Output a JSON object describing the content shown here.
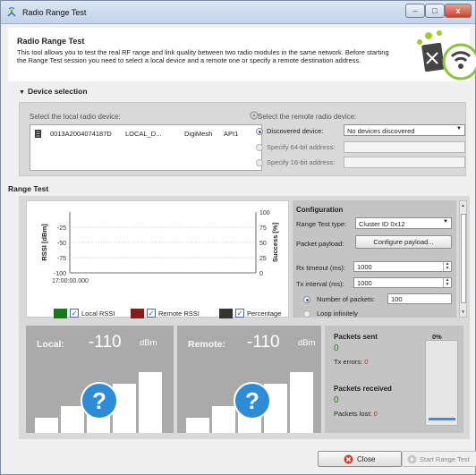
{
  "window": {
    "title": "Radio Range Test",
    "controls": {
      "minimize": "–",
      "maximize": "□",
      "close": "x"
    }
  },
  "header": {
    "title": "Radio Range Test",
    "description": "This tool allows you to test the real RF range and link quality between two radio modules in the same network. Before starting the Range Test session you need to select a local device and a remote one or specify a remote destination address."
  },
  "device_selection": {
    "section_title": "Device selection",
    "local_label": "Select the local radio device:",
    "local_devices": [
      {
        "address": "0013A2004074187D",
        "name": "LOCAL_D...",
        "protocol": "DigiMesh",
        "mode": "API1"
      }
    ],
    "remote_label": "Select the remote radio device:",
    "remote_options": {
      "discovered_label": "Discovered device:",
      "discovered_value": "No devices discovered",
      "addr64_label": "Specify 64-bit address:",
      "addr16_label": "Specify 16-bit address:",
      "selected": "discovered"
    }
  },
  "range_test": {
    "section_title": "Range Test",
    "configuration": {
      "title": "Configuration",
      "type_label": "Range Test type:",
      "type_value": "Cluster ID 0x12",
      "payload_label": "Packet payload:",
      "payload_button": "Configure payload...",
      "rx_timeout_label": "Rx timeout (ms):",
      "rx_timeout_value": "1000",
      "tx_interval_label": "Tx interval (ms):",
      "tx_interval_value": "1000",
      "num_packets_label": "Number of packets:",
      "num_packets_value": "100",
      "loop_label": "Loop infinitely",
      "mode_selected": "number"
    },
    "legend": [
      {
        "label": "Local RSSI",
        "color": "#1a7a1a",
        "checked": true
      },
      {
        "label": "Remote RSSI",
        "color": "#8b1a1a",
        "checked": true
      },
      {
        "label": "Percentage",
        "color": "#333333",
        "checked": true
      }
    ],
    "local": {
      "label": "Local:",
      "value": "-110",
      "unit": "dBm",
      "signal_icon": "question-mark-icon"
    },
    "remote": {
      "label": "Remote:",
      "value": "-110",
      "unit": "dBm",
      "signal_icon": "question-mark-icon"
    },
    "stats": {
      "sent_label": "Packets sent",
      "sent_value": "0",
      "tx_errors_label": "Tx errors:",
      "tx_errors_value": "0",
      "received_label": "Packets received",
      "received_value": "0",
      "lost_label": "Packets lost:",
      "lost_value": "0",
      "percentage": "0%",
      "percentage_fraction": 0.0
    }
  },
  "chart_data": {
    "type": "line",
    "ylabel": "RSSI [dBm]",
    "y2label": "Success [%]",
    "y_ticks": [
      "-25",
      "-50",
      "-75",
      "-100"
    ],
    "ylim": [
      -100,
      0
    ],
    "y2_ticks": [
      "100",
      "75",
      "50",
      "25",
      "0"
    ],
    "y2lim": [
      0,
      100
    ],
    "x_ticks": [
      "17:00:00.000"
    ],
    "series": [
      {
        "name": "Local RSSI",
        "values": []
      },
      {
        "name": "Remote RSSI",
        "values": []
      },
      {
        "name": "Percentage",
        "values": []
      }
    ],
    "grid": true
  },
  "footer": {
    "close_label": "Close",
    "start_label": "Start Range Test"
  },
  "colors": {
    "accent_green": "#2f7a2f",
    "error_red": "#c42a2a",
    "progress_blue": "#3a8fd8"
  }
}
